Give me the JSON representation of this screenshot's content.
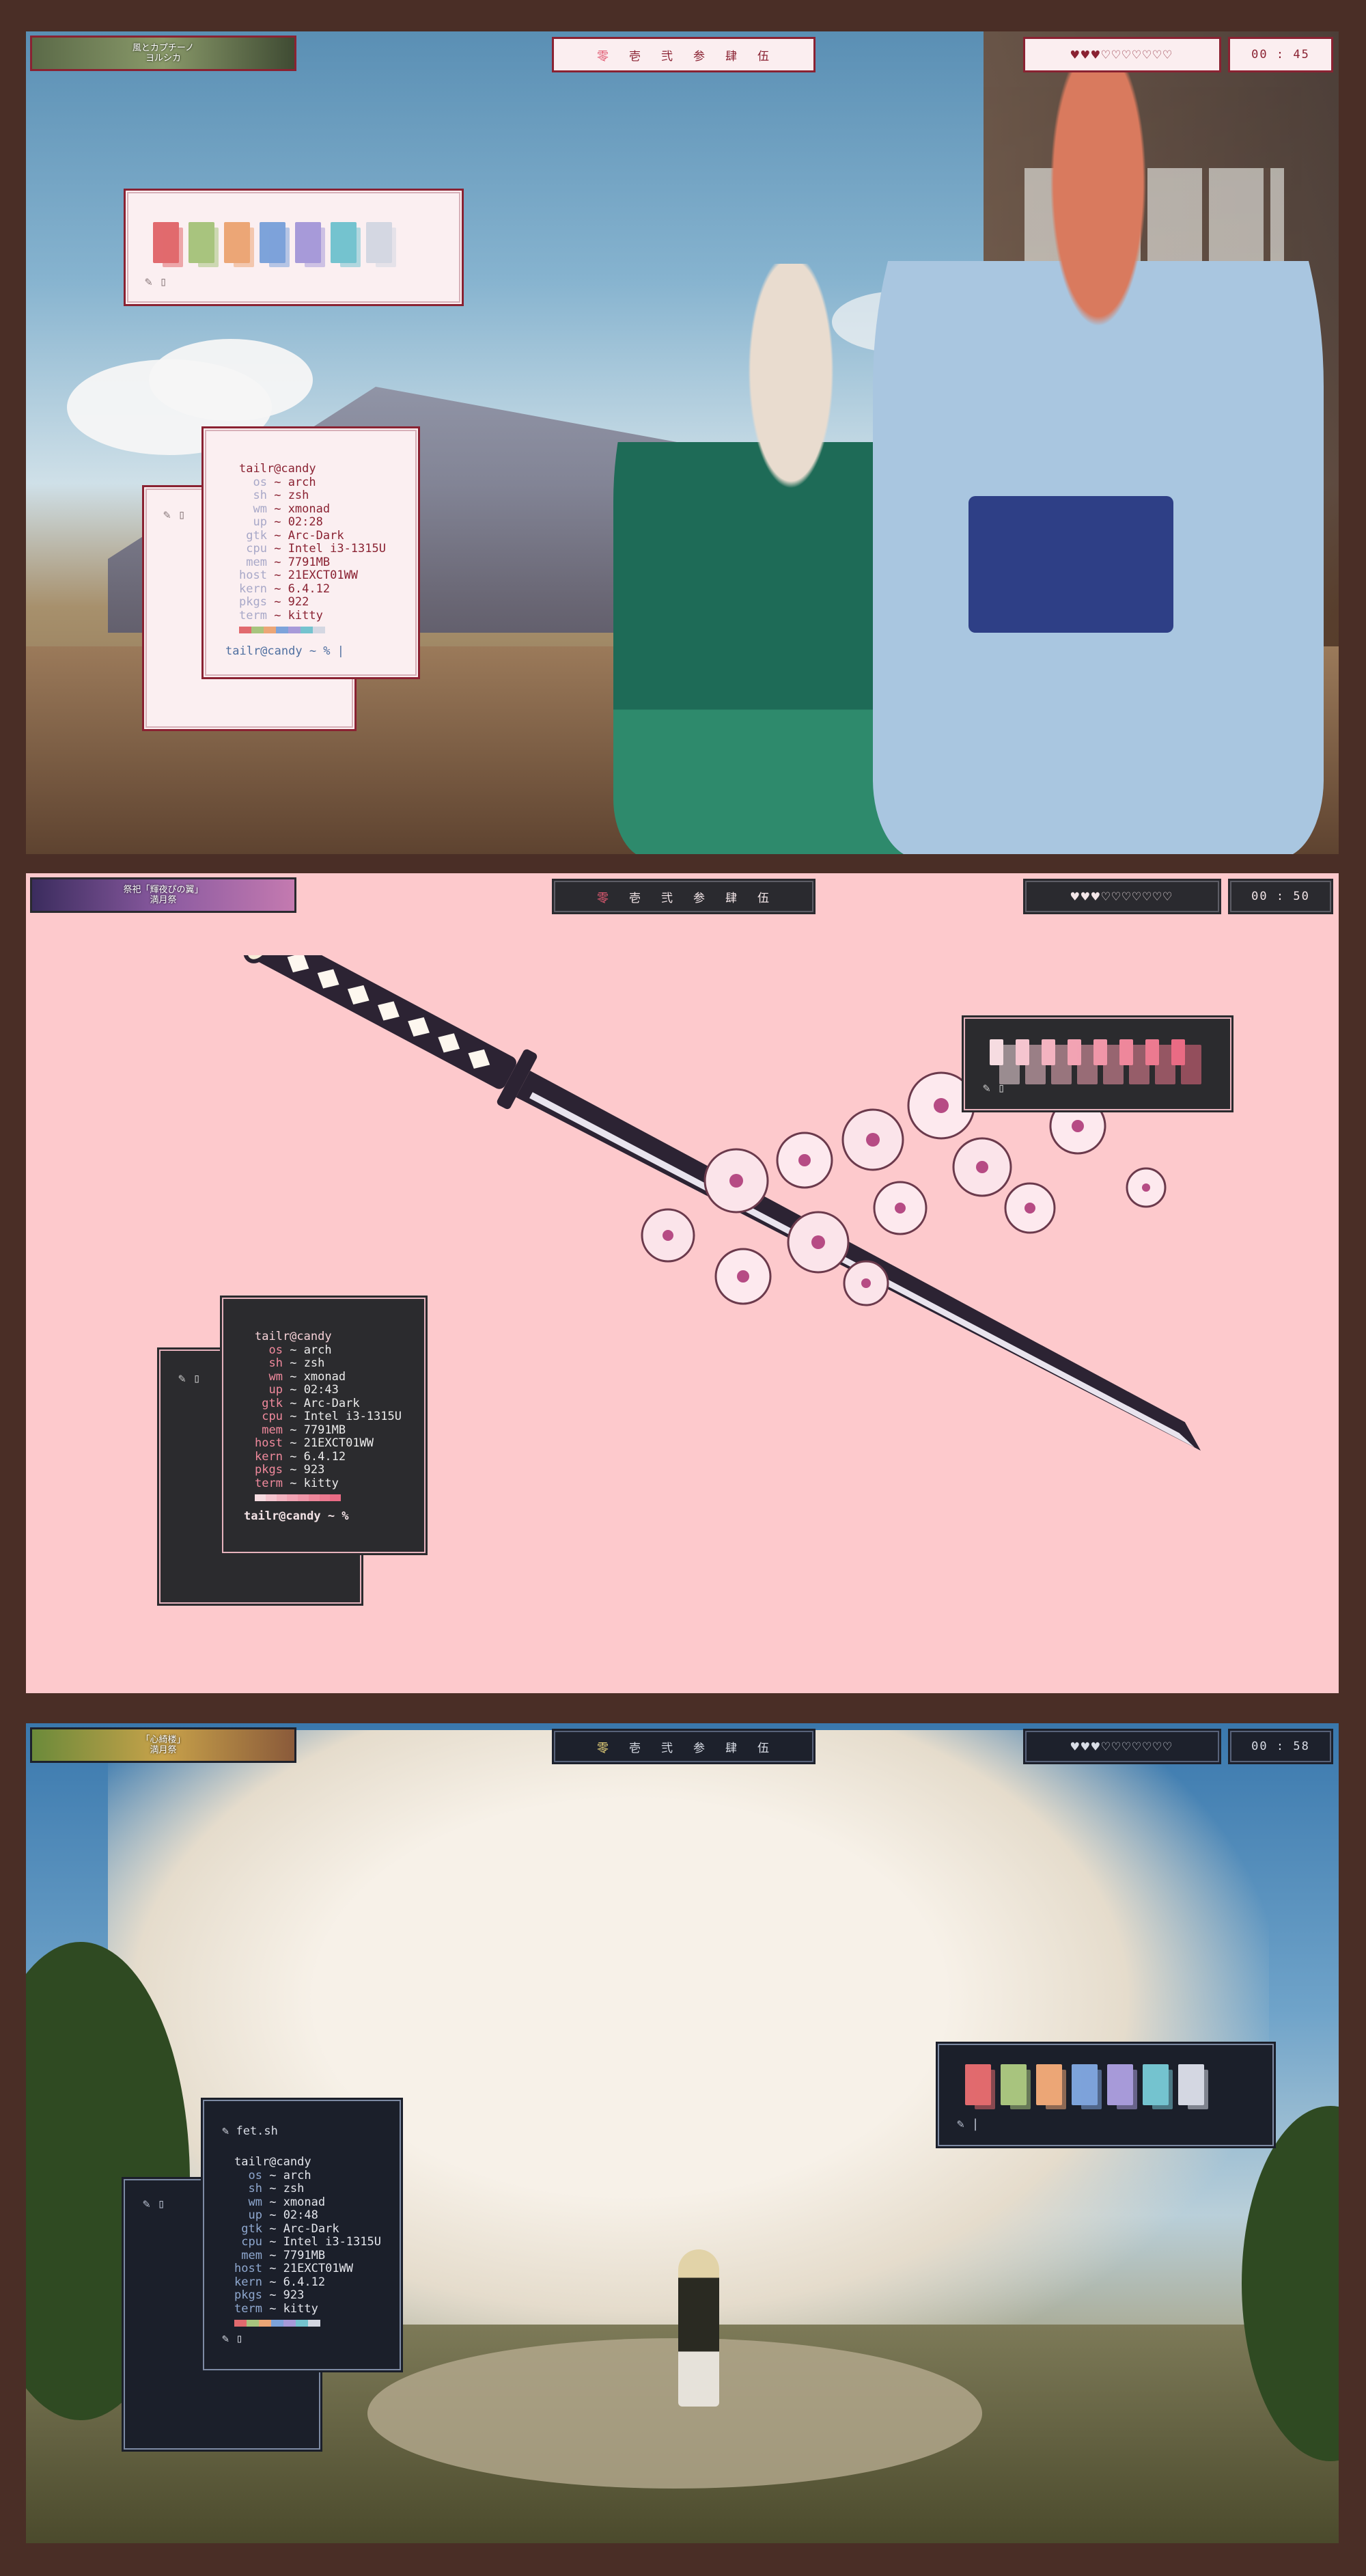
{
  "colors": {
    "frame": "#4a2e26",
    "screen2_bg": "#fdc9cc",
    "light_accent": "#8a2232",
    "dark_window": "#2b2b2e",
    "navy_window": "#1b1f2a"
  },
  "palette": [
    "#e16a6e",
    "#a8c47e",
    "#eca676",
    "#7da3da",
    "#a79ad9",
    "#74c3cf",
    "#d4d7e2"
  ],
  "palette_pink": [
    "#f6dce1",
    "#f5c5cf",
    "#f3b3c0",
    "#f2a3b3",
    "#f096a8",
    "#ee879b",
    "#ec7a90",
    "#e96b84"
  ],
  "screens": [
    {
      "theme": "light",
      "music": {
        "line1": "風とカプチーノ",
        "line2": "ヨルシカ"
      },
      "workspaces": [
        "零",
        "壱",
        "弐",
        "参",
        "肆",
        "伍"
      ],
      "active_workspace": 0,
      "hearts": "♥♥♥♡♡♡♡♡♡♡",
      "clock": "00 : 45",
      "palette_prompt": "✎ ▯",
      "back_prompt": "✎ ▯",
      "fetch": {
        "user": "tailr@candy",
        "rows": [
          {
            "k": "os",
            "v": "arch"
          },
          {
            "k": "sh",
            "v": "zsh"
          },
          {
            "k": "wm",
            "v": "xmonad"
          },
          {
            "k": "up",
            "v": "02:28"
          },
          {
            "k": "gtk",
            "v": "Arc-Dark"
          },
          {
            "k": "cpu",
            "v": "Intel i3-1315U"
          },
          {
            "k": "mem",
            "v": "7791MB"
          },
          {
            "k": "host",
            "v": "21EXCT01WW"
          },
          {
            "k": "kern",
            "v": "6.4.12"
          },
          {
            "k": "pkgs",
            "v": "922"
          },
          {
            "k": "term",
            "v": "kitty"
          }
        ],
        "prompt": "tailr@candy ~ % |"
      }
    },
    {
      "theme": "dark",
      "music": {
        "line1": "祭祀「輝夜ぴの翼」",
        "line2": "満月祭"
      },
      "workspaces": [
        "零",
        "壱",
        "弐",
        "参",
        "肆",
        "伍"
      ],
      "active_workspace": 0,
      "hearts": "♥♥♥♡♡♡♡♡♡♡",
      "clock": "00 : 50",
      "palette_prompt": "✎ ▯",
      "back_prompt": "✎ ▯",
      "fetch": {
        "user": "tailr@candy",
        "rows": [
          {
            "k": "os",
            "v": "arch"
          },
          {
            "k": "sh",
            "v": "zsh"
          },
          {
            "k": "wm",
            "v": "xmonad"
          },
          {
            "k": "up",
            "v": "02:43"
          },
          {
            "k": "gtk",
            "v": "Arc-Dark"
          },
          {
            "k": "cpu",
            "v": "Intel i3-1315U"
          },
          {
            "k": "mem",
            "v": "7791MB"
          },
          {
            "k": "host",
            "v": "21EXCT01WW"
          },
          {
            "k": "kern",
            "v": "6.4.12"
          },
          {
            "k": "pkgs",
            "v": "923"
          },
          {
            "k": "term",
            "v": "kitty"
          }
        ],
        "prompt": "tailr@candy ~ %"
      }
    },
    {
      "theme": "navy",
      "music": {
        "line1": "「心綺楼」",
        "line2": "満月祭"
      },
      "workspaces": [
        "零",
        "壱",
        "弐",
        "参",
        "肆",
        "伍"
      ],
      "active_workspace": 0,
      "hearts": "♥♥♥♡♡♡♡♡♡♡",
      "clock": "00 : 58",
      "palette_prompt": "✎ |",
      "back_prompt": "✎ ▯",
      "fetch": {
        "header": "✎ fet.sh",
        "user": "tailr@candy",
        "rows": [
          {
            "k": "os",
            "v": "arch"
          },
          {
            "k": "sh",
            "v": "zsh"
          },
          {
            "k": "wm",
            "v": "xmonad"
          },
          {
            "k": "up",
            "v": "02:48"
          },
          {
            "k": "gtk",
            "v": "Arc-Dark"
          },
          {
            "k": "cpu",
            "v": "Intel i3-1315U"
          },
          {
            "k": "mem",
            "v": "7791MB"
          },
          {
            "k": "host",
            "v": "21EXCT01WW"
          },
          {
            "k": "kern",
            "v": "6.4.12"
          },
          {
            "k": "pkgs",
            "v": "923"
          },
          {
            "k": "term",
            "v": "kitty"
          }
        ],
        "prompt": "✎ ▯"
      }
    }
  ]
}
